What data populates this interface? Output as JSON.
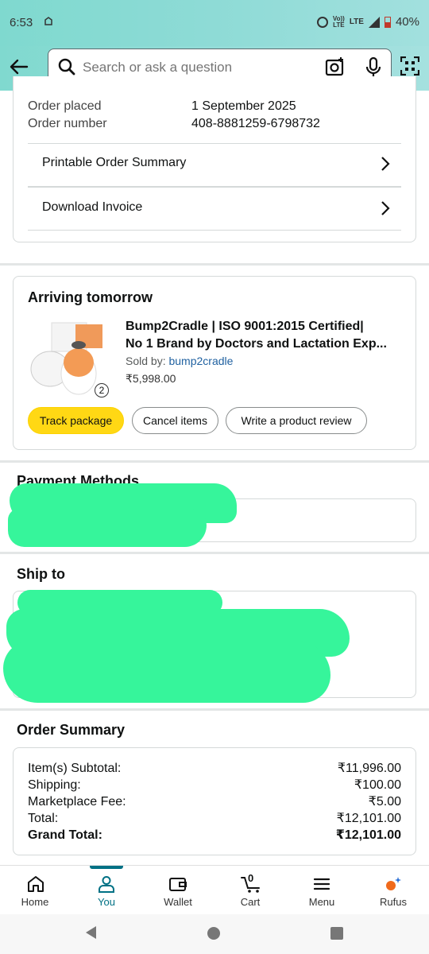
{
  "status_bar": {
    "time": "6:53",
    "network_top": "Vo))",
    "network_bottom": "LTE",
    "lte": "LTE",
    "battery": "40%"
  },
  "header": {
    "search_placeholder": "Search or ask a question"
  },
  "order_info": {
    "placed_label": "Order placed",
    "placed_value": "1 September 2025",
    "number_label": "Order number",
    "number_value": "408-8881259-6798732",
    "printable_summary": "Printable Order Summary",
    "download_invoice": "Download Invoice"
  },
  "shipment": {
    "title": "Arriving tomorrow",
    "product_line1": "Bump2Cradle | ISO 9001:2015 Certified|",
    "product_line2": "No 1 Brand by Doctors and Lactation Exp...",
    "sold_by_label": "Sold by:",
    "seller": "bump2cradle",
    "price": "₹5,998.00",
    "quantity": "2",
    "track_button": "Track package",
    "cancel_button": "Cancel items",
    "review_button": "Write a product review"
  },
  "payment": {
    "title": "Payment Methods"
  },
  "ship_to": {
    "title": "Ship to"
  },
  "order_summary": {
    "title": "Order Summary",
    "rows": [
      {
        "label": "Item(s) Subtotal:",
        "value": "₹11,996.00"
      },
      {
        "label": "Shipping:",
        "value": "₹100.00"
      },
      {
        "label": "Marketplace Fee:",
        "value": "₹5.00"
      },
      {
        "label": "Total:",
        "value": "₹12,101.00"
      }
    ],
    "grand_total_label": "Grand Total:",
    "grand_total_value": "₹12,101.00"
  },
  "bottom_nav": {
    "items": [
      {
        "label": "Home",
        "icon": "home-icon"
      },
      {
        "label": "You",
        "icon": "person-icon"
      },
      {
        "label": "Wallet",
        "icon": "wallet-icon"
      },
      {
        "label": "Cart",
        "icon": "cart-icon",
        "badge": "0"
      },
      {
        "label": "Menu",
        "icon": "menu-icon"
      },
      {
        "label": "Rufus",
        "icon": "rufus-icon"
      }
    ],
    "active": "You",
    "active_color": "#007185"
  },
  "colors": {
    "header_gradient": "#8edbd6",
    "track_button": "#ffd814",
    "redaction": "#36f59b",
    "link": "#007185"
  }
}
